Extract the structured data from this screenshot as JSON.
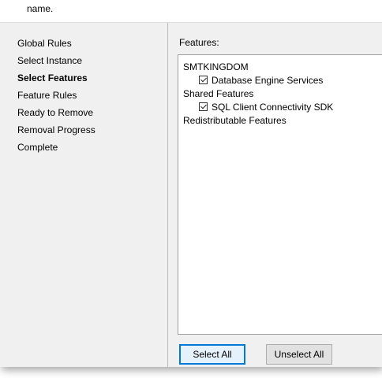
{
  "header": {
    "text": "name."
  },
  "sidebar": {
    "steps": [
      {
        "label": "Global Rules",
        "active": false
      },
      {
        "label": "Select Instance",
        "active": false
      },
      {
        "label": "Select Features",
        "active": true
      },
      {
        "label": "Feature Rules",
        "active": false
      },
      {
        "label": "Ready to Remove",
        "active": false
      },
      {
        "label": "Removal Progress",
        "active": false
      },
      {
        "label": "Complete",
        "active": false
      }
    ]
  },
  "main": {
    "features_label": "Features:",
    "tree": [
      {
        "label": "SMTKINGDOM",
        "checkbox": false
      },
      {
        "label": "Database Engine Services",
        "checkbox": true,
        "checked": true
      },
      {
        "label": "Shared Features",
        "checkbox": false
      },
      {
        "label": "SQL Client Connectivity SDK",
        "checkbox": true,
        "checked": true
      },
      {
        "label": "Redistributable Features",
        "checkbox": false
      }
    ],
    "buttons": {
      "select_all": "Select All",
      "unselect_all": "Unselect All"
    }
  }
}
